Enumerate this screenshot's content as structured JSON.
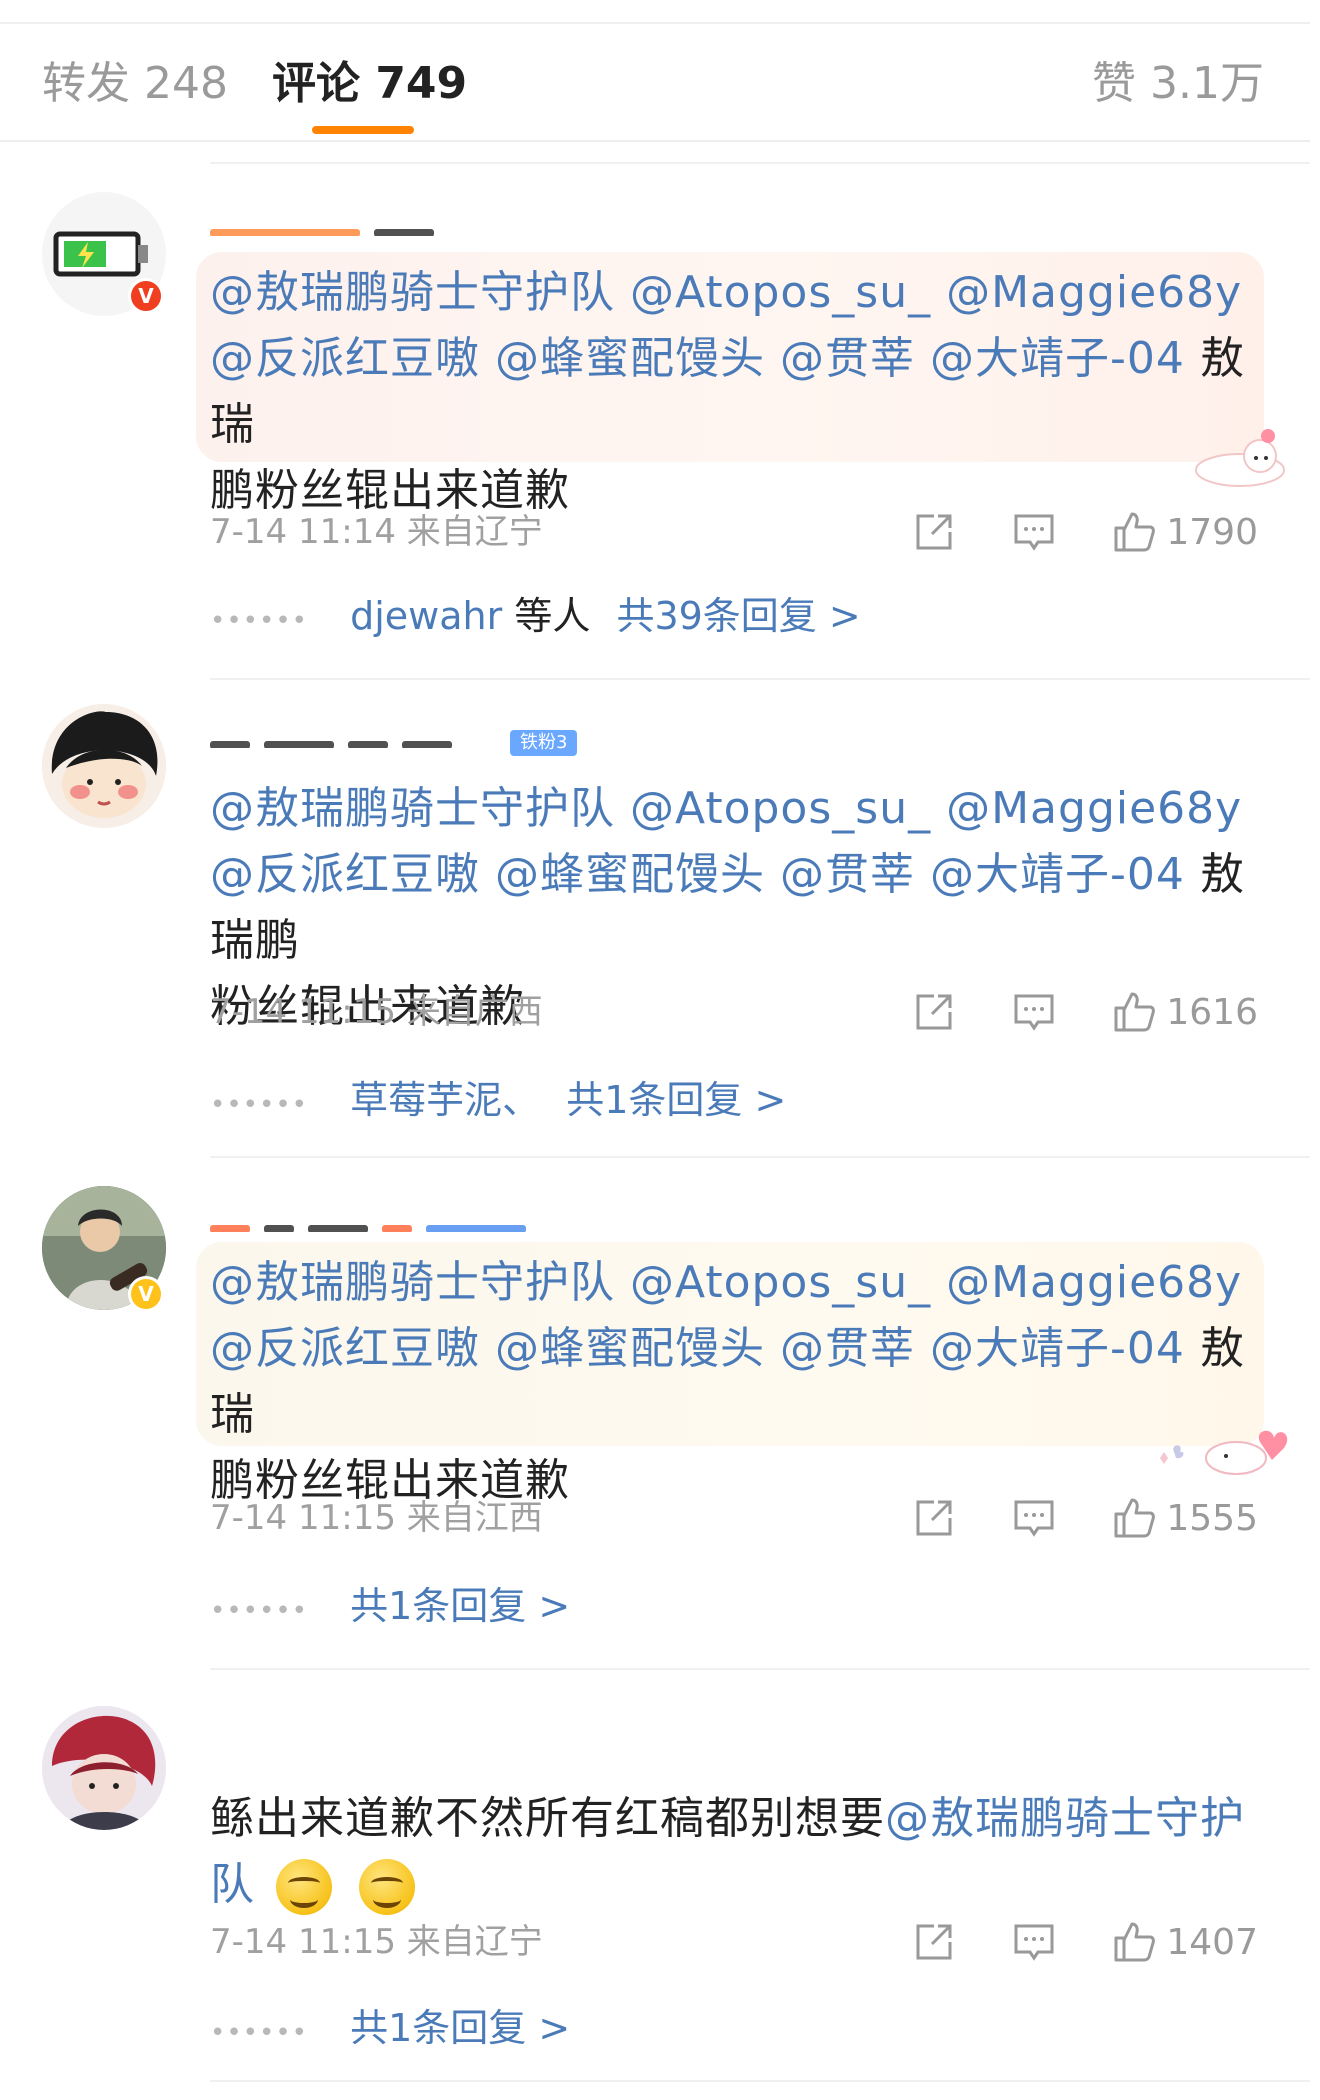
{
  "tabs": {
    "repost": "转发 248",
    "comments": "评论 749",
    "likes": "赞 3.1万"
  },
  "comments": [
    {
      "text": {
        "m1": "@敖瑞鹏骑士守护队",
        "m2": "@Atopos_su_",
        "m3": "@Maggie68y",
        "m4": "@反派红豆嗷",
        "m5": "@蜂蜜配馒头",
        "m6": "@贯莘",
        "m7": "@大靖子-04",
        "plain_a": "敖瑞",
        "plain_b": "鹏粉丝辊出来道歉"
      },
      "time": "7-14 11:14",
      "location": "来自辽宁",
      "likes": "1790",
      "replies": {
        "users": "djewahr",
        "etc": "等人",
        "total": "共39条回复 >"
      }
    },
    {
      "fan_badge": "铁粉3",
      "text": {
        "m1": "@敖瑞鹏骑士守护队",
        "m2": "@Atopos_su_",
        "m3": "@Maggie68y",
        "m4": "@反派红豆嗷",
        "m5": "@蜂蜜配馒头",
        "m6": "@贯莘",
        "m7": "@大靖子-04",
        "plain_a": "敖瑞鹏",
        "plain_b": "粉丝辊出来道歉"
      },
      "time": "7-14 11:15",
      "location": "来自广西",
      "likes": "1616",
      "replies": {
        "users": "草莓芋泥、",
        "total": "共1条回复 >"
      }
    },
    {
      "text": {
        "m1": "@敖瑞鹏骑士守护队",
        "m2": "@Atopos_su_",
        "m3": "@Maggie68y",
        "m4": "@反派红豆嗷",
        "m5": "@蜂蜜配馒头",
        "m6": "@贯莘",
        "m7": "@大靖子-04",
        "plain_a": "敖瑞",
        "plain_b": "鹏粉丝辊出来道歉"
      },
      "time": "7-14 11:15",
      "location": "来自江西",
      "likes": "1555",
      "replies": {
        "total": "共1条回复 >"
      }
    },
    {
      "text": {
        "plain_a": "鲧出来道歉不然所有红稿都别想要",
        "m1": "@敖瑞鹏骑士守护",
        "m1b": "队"
      },
      "time": "7-14 11:15",
      "location": "来自辽宁",
      "likes": "1407",
      "replies": {
        "total": "共1条回复 >"
      }
    }
  ],
  "icons": {
    "share": "share-icon",
    "comment": "comment-icon",
    "like": "thumbs-up-icon",
    "more": "ellipsis-icon"
  },
  "colors": {
    "accent": "#ff8200",
    "mention": "#4a7bb8",
    "meta": "#a0a0a0"
  }
}
